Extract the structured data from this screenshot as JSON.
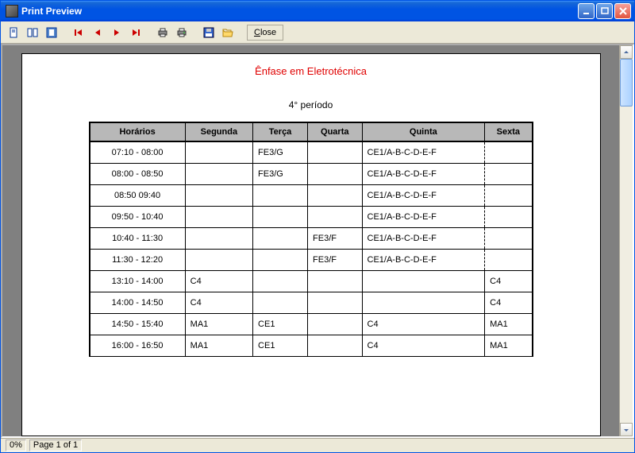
{
  "window": {
    "title": "Print Preview"
  },
  "toolbar": {
    "close_label": "Close"
  },
  "status": {
    "progress": "0%",
    "page_info": "Page 1 of 1"
  },
  "document": {
    "title": "Ênfase em Eletrotécnica",
    "subtitle": "4° período",
    "columns": [
      "Horários",
      "Segunda",
      "Terça",
      "Quarta",
      "Quinta",
      "Sexta"
    ],
    "rows": [
      {
        "time": "07:10 - 08:00",
        "seg": "",
        "ter": "FE3/G",
        "qua": "",
        "qui": "CE1/A-B-C-D-E-F",
        "sex": "",
        "merge_qui_sex": true
      },
      {
        "time": "08:00 - 08:50",
        "seg": "",
        "ter": "FE3/G",
        "qua": "",
        "qui": "CE1/A-B-C-D-E-F",
        "sex": "",
        "merge_qui_sex": true
      },
      {
        "time": "08:50   09:40",
        "seg": "",
        "ter": "",
        "qua": "",
        "qui": "CE1/A-B-C-D-E-F",
        "sex": "",
        "merge_qui_sex": true
      },
      {
        "time": "09:50 - 10:40",
        "seg": "",
        "ter": "",
        "qua": "",
        "qui": "CE1/A-B-C-D-E-F",
        "sex": "",
        "merge_qui_sex": true
      },
      {
        "time": "10:40 - 11:30",
        "seg": "",
        "ter": "",
        "qua": "FE3/F",
        "qui": "CE1/A-B-C-D-E-F",
        "sex": "",
        "merge_qui_sex": true
      },
      {
        "time": "11:30 - 12:20",
        "seg": "",
        "ter": "",
        "qua": "FE3/F",
        "qui": "CE1/A-B-C-D-E-F",
        "sex": "",
        "merge_qui_sex": true
      },
      {
        "time": "13:10 - 14:00",
        "seg": "C4",
        "ter": "",
        "qua": "",
        "qui": "",
        "sex": "C4",
        "merge_qui_sex": false
      },
      {
        "time": "14:00 - 14:50",
        "seg": "C4",
        "ter": "",
        "qua": "",
        "qui": "",
        "sex": "C4",
        "merge_qui_sex": false
      },
      {
        "time": "14:50 - 15:40",
        "seg": "MA1",
        "ter": "CE1",
        "qua": "",
        "qui": "C4",
        "sex": "MA1",
        "merge_qui_sex": false
      },
      {
        "time": "16:00 - 16:50",
        "seg": "MA1",
        "ter": "CE1",
        "qua": "",
        "qui": "C4",
        "sex": "MA1",
        "merge_qui_sex": false
      }
    ]
  }
}
